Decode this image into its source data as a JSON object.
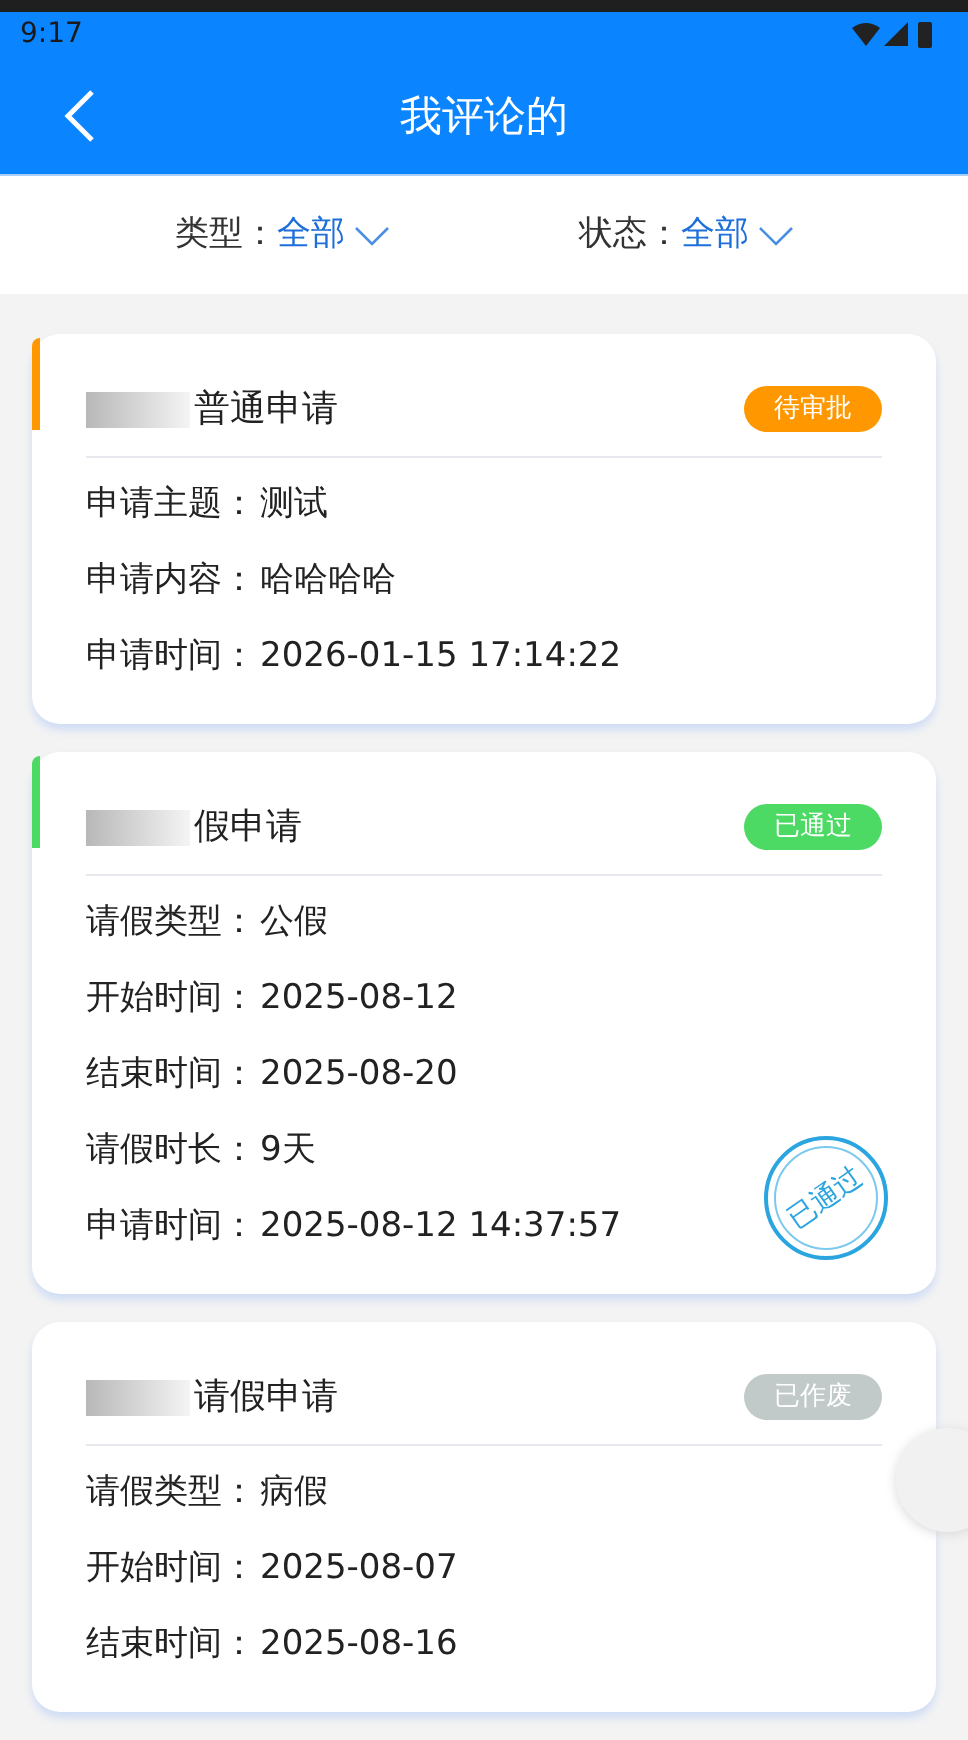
{
  "status_bar": {
    "time": "9:17"
  },
  "header": {
    "title": "我评论的"
  },
  "filters": [
    {
      "label": "类型：",
      "value": "全部"
    },
    {
      "label": "状态：",
      "value": "全部"
    }
  ],
  "cards": [
    {
      "title": "普通申请",
      "accent_bar": true,
      "status": "待审批",
      "color": "#ff9800",
      "fields": [
        {
          "label": "申请主题：",
          "value": "测试"
        },
        {
          "label": "申请内容：",
          "value": "哈哈哈哈"
        },
        {
          "label": "申请时间：",
          "value": "2026-01-15 17:14:22"
        }
      ]
    },
    {
      "title": "假申请",
      "accent_bar": true,
      "status": "已通过",
      "color": "#4cd964",
      "stamp": "已通过",
      "fields": [
        {
          "label": "请假类型：",
          "value": "公假"
        },
        {
          "label": "开始时间：",
          "value": "2025-08-12"
        },
        {
          "label": "结束时间：",
          "value": "2025-08-20"
        },
        {
          "label": "请假时长：",
          "value": "9天"
        },
        {
          "label": "申请时间：",
          "value": "2025-08-12 14:37:57"
        }
      ]
    },
    {
      "title": "请假申请",
      "accent_bar": false,
      "status": "已作废",
      "color": "#c2c9c9",
      "fields": [
        {
          "label": "请假类型：",
          "value": "病假"
        },
        {
          "label": "开始时间：",
          "value": "2025-08-07"
        },
        {
          "label": "结束时间：",
          "value": "2025-08-16"
        }
      ]
    }
  ]
}
